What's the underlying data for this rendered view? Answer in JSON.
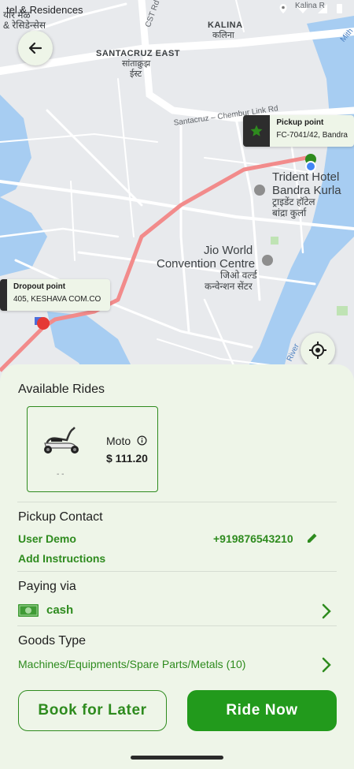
{
  "status_bar": {
    "left_text": "tel & Residences"
  },
  "map": {
    "labels": {
      "top_left_1": "tel & Residences",
      "top_left_2": "यार मेळ",
      "top_left_3": "& रेसिडेन्सेस",
      "kalina": "KALINA",
      "kalina_hi": "कलिना",
      "kalina_rd": "Kalina R",
      "cst_rd": "CST Rd",
      "santacruz_east": "SANTACRUZ EAST",
      "santacruz_hi_1": "सांताक्रुझ",
      "santacruz_hi_2": "ईस्ट",
      "chembur_link": "Santacruz – Chembur Link Rd",
      "trident_1": "Trident Hotel",
      "trident_2": "Bandra Kurla",
      "trident_hi_1": "ट्राइडेंट हॉटेल",
      "trident_hi_2": "बांद्रा कुर्ला",
      "jio_1": "Jio World",
      "jio_2": "Convention Centre",
      "jio_hi_1": "जिओ वर्ल्ड",
      "jio_hi_2": "कन्वेन्शन सेंटर",
      "river": "River",
      "mithi": "Mith"
    },
    "pickup": {
      "title": "Pickup point",
      "address": "FC-7041/42, Bandra"
    },
    "dropout": {
      "title": "Dropout point",
      "address": "405, KESHAVA COM.CO"
    }
  },
  "sheet": {
    "available_rides_title": "Available Rides",
    "ride": {
      "name": "Moto",
      "price": "$ 111.20",
      "sub": "- -"
    },
    "pickup_contact_title": "Pickup Contact",
    "contact_name": "User Demo",
    "contact_phone": "+919876543210",
    "add_instructions": "Add Instructions",
    "paying_via_title": "Paying via",
    "payment_method": "cash",
    "goods_type_title": "Goods Type",
    "goods_type_value": "Machines/Equipments/Spare Parts/Metals (10)",
    "book_later_label": "Book for Later",
    "ride_now_label": "Ride Now"
  },
  "colors": {
    "accent": "#229a1c",
    "sheet_bg": "#eef5e8",
    "route": "#f28b8b",
    "water": "#a7cdf2"
  },
  "icons": [
    "back-arrow-icon",
    "star-icon",
    "flag-icon",
    "my-location-icon",
    "info-icon",
    "edit-icon",
    "cash-icon",
    "chevron-right-icon",
    "scooter-icon"
  ]
}
